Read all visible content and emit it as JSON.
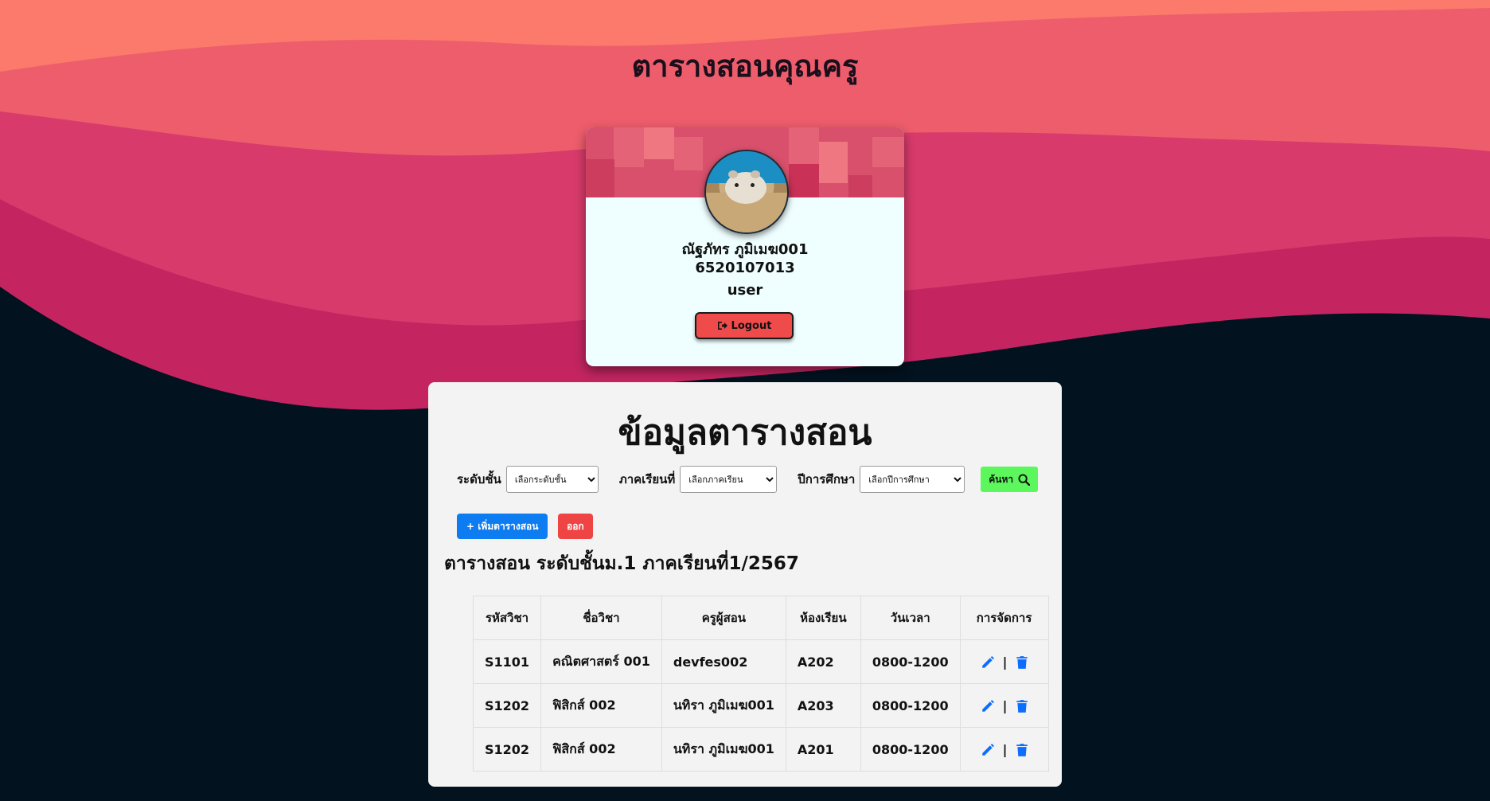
{
  "page": {
    "title": "ตารางสอนคุณครู",
    "colors": {
      "wave_light": "#fb7a6c",
      "wave_mid": "#ee5d6c",
      "wave_pink": "#d83b6b",
      "wave_deep": "#c42561",
      "background_dark": "#02121f"
    }
  },
  "profile": {
    "name": "ณัฐภัทร ภูมิเมฆ001",
    "student_id": "6520107013",
    "role": "user",
    "avatar_icon": "hamster-photo",
    "logout_icon": "sign-out-icon",
    "logout_label": "Logout"
  },
  "panel": {
    "title": "ข้อมูลตารางสอน",
    "filters": {
      "level_label": "ระดับชั้น",
      "level_selected": "เลือกระดับชั้น",
      "term_label": "ภาคเรียนที่",
      "term_selected": "เลือกภาคเรียน",
      "year_label": "ปีการศึกษา",
      "year_selected": "เลือกปีการศึกษา",
      "search_label": "ค้นหา",
      "search_icon": "search-icon"
    },
    "add_label": "+ เพิ่มตารางสอน",
    "exit_label": "ออก",
    "table_heading": "ตารางสอน ระดับชั้นม.1 ภาคเรียนที่1/2567",
    "table": {
      "headers": [
        "รหัสวิชา",
        "ชื่อวิชา",
        "ครูผู้สอน",
        "ห้องเรียน",
        "วันเวลา",
        "การจัดการ"
      ],
      "rows": [
        {
          "code": "S1101",
          "subject": "คณิตศาสตร์ 001",
          "teacher": "devfes002",
          "room": "A202",
          "time": "0800-1200"
        },
        {
          "code": "S1202",
          "subject": "ฟิสิกส์ 002",
          "teacher": "นทิรา ภูมิเมฆ001",
          "room": "A203",
          "time": "0800-1200"
        },
        {
          "code": "S1202",
          "subject": "ฟิสิกส์ 002",
          "teacher": "นทิรา ภูมิเมฆ001",
          "room": "A201",
          "time": "0800-1200"
        }
      ],
      "action_separator": "|",
      "edit_icon": "pencil-icon",
      "delete_icon": "trash-icon",
      "action_color": "#0d6efd"
    }
  }
}
